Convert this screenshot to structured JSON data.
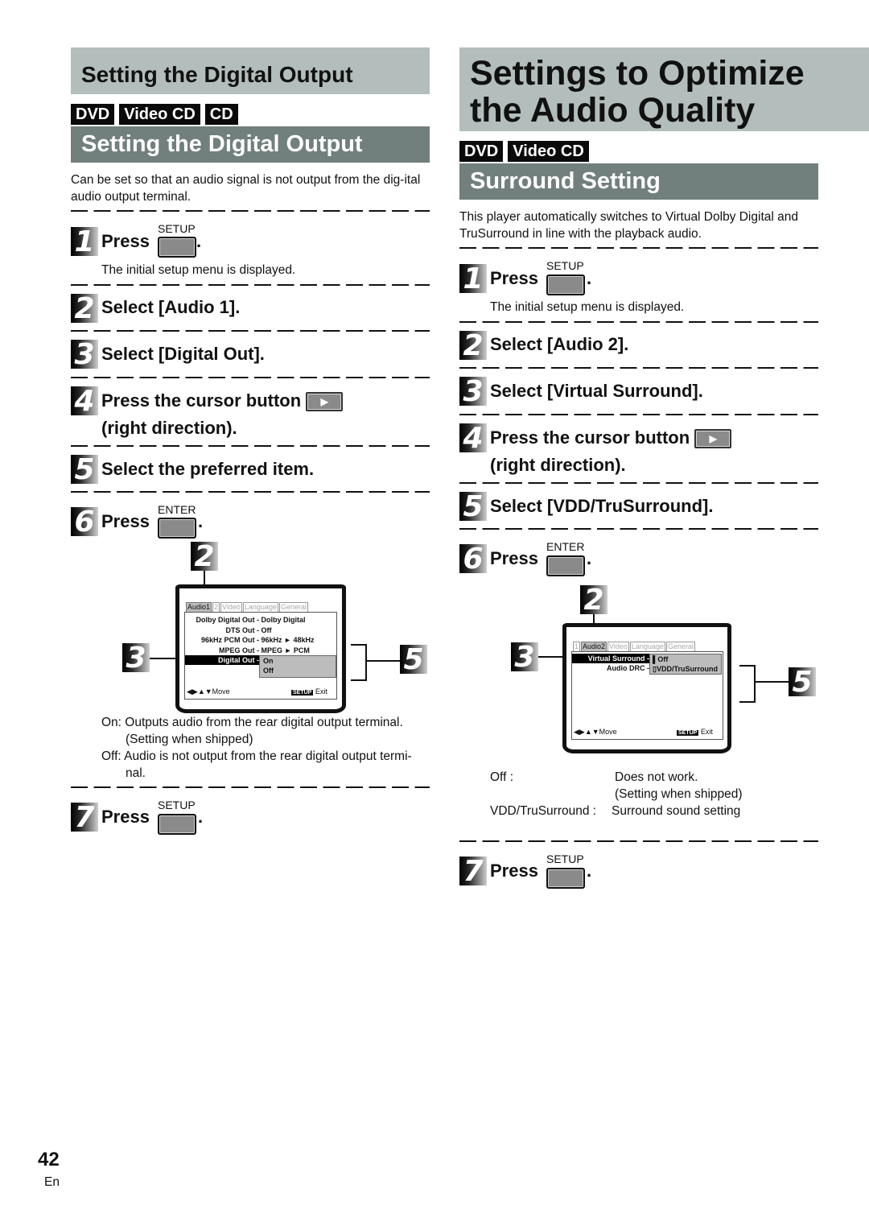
{
  "left": {
    "section_title": "Setting the Digital Output",
    "disc_badges": [
      "DVD",
      "Video CD",
      "CD"
    ],
    "subsection_title": "Setting the Digital Output",
    "description": "Can be set so that an audio signal is not output from the dig-ital audio output terminal.",
    "steps": [
      {
        "num": "1",
        "text": "Press",
        "key_label": "SETUP",
        "note": "The initial setup menu is displayed."
      },
      {
        "num": "2",
        "text": "Select [Audio 1]."
      },
      {
        "num": "3",
        "text": "Select [Digital Out]."
      },
      {
        "num": "4",
        "text": "Press the cursor button",
        "text2": "(right direction).",
        "cursor_glyph": "▶"
      },
      {
        "num": "5",
        "text": "Select the preferred item."
      },
      {
        "num": "6",
        "text": "Press",
        "key_label": "ENTER"
      },
      {
        "num": "7",
        "text": "Press",
        "key_label": "SETUP"
      }
    ],
    "screen": {
      "tabs": [
        "Audio1",
        "2",
        "Video",
        "Language",
        "General"
      ],
      "active_tab": 0,
      "rows": [
        {
          "label": "Dolby Digital Out -",
          "value": "Dolby Digital"
        },
        {
          "label": "DTS Out -",
          "value": "Off"
        },
        {
          "label": "96kHz PCM Out -",
          "value": "96kHz ► 48kHz"
        },
        {
          "label": "MPEG Out -",
          "value": "MPEG ► PCM"
        },
        {
          "label": "Digital Out -",
          "value": ""
        }
      ],
      "options": [
        "On",
        "Off"
      ],
      "footer_move": "Move",
      "footer_setup": "SETUP",
      "footer_exit": "Exit",
      "callouts": [
        "2",
        "3",
        "5"
      ]
    },
    "options_desc": [
      {
        "key": "On:",
        "text": "Outputs audio from the rear digital output terminal.",
        "text2": "(Setting when shipped)"
      },
      {
        "key": "Off:",
        "text": "Audio is not output from the rear digital output termi-",
        "text2": "nal."
      }
    ]
  },
  "right": {
    "section_title_line1": "Settings to Optimize",
    "section_title_line2": "the Audio Quality",
    "disc_badges": [
      "DVD",
      "Video CD"
    ],
    "subsection_title": "Surround Setting",
    "description_line1": "This player automatically switches to Virtual Dolby Digital and",
    "description_line2": "TruSurround in line with the playback audio.",
    "steps": [
      {
        "num": "1",
        "text": "Press",
        "key_label": "SETUP",
        "note": "The initial setup menu is displayed."
      },
      {
        "num": "2",
        "text": "Select [Audio 2]."
      },
      {
        "num": "3",
        "text": "Select [Virtual Surround]."
      },
      {
        "num": "4",
        "text": "Press the cursor button",
        "text2": "(right direction).",
        "cursor_glyph": "▶"
      },
      {
        "num": "5",
        "text": "Select [VDD/TruSurround]."
      },
      {
        "num": "6",
        "text": "Press",
        "key_label": "ENTER"
      },
      {
        "num": "7",
        "text": "Press",
        "key_label": "SETUP"
      }
    ],
    "screen": {
      "tabs": [
        "1",
        "Audio2",
        "Video",
        "Language",
        "General"
      ],
      "active_tab": 1,
      "rows": [
        {
          "label": "Virtual Surround -",
          "value": ""
        },
        {
          "label": "Audio DRC -",
          "value": ""
        }
      ],
      "options": [
        "Off",
        "VDD/TruSurround"
      ],
      "footer_move": "Move",
      "footer_setup": "SETUP",
      "footer_exit": "Exit",
      "callouts": [
        "2",
        "3",
        "5"
      ]
    },
    "options_desc": [
      {
        "key": "Off :",
        "text": "Does not work.",
        "text2": "(Setting when shipped)"
      },
      {
        "key": "VDD/TruSurround :",
        "text": "Surround sound setting"
      }
    ]
  },
  "footer": {
    "page_number": "42",
    "language": "En"
  }
}
